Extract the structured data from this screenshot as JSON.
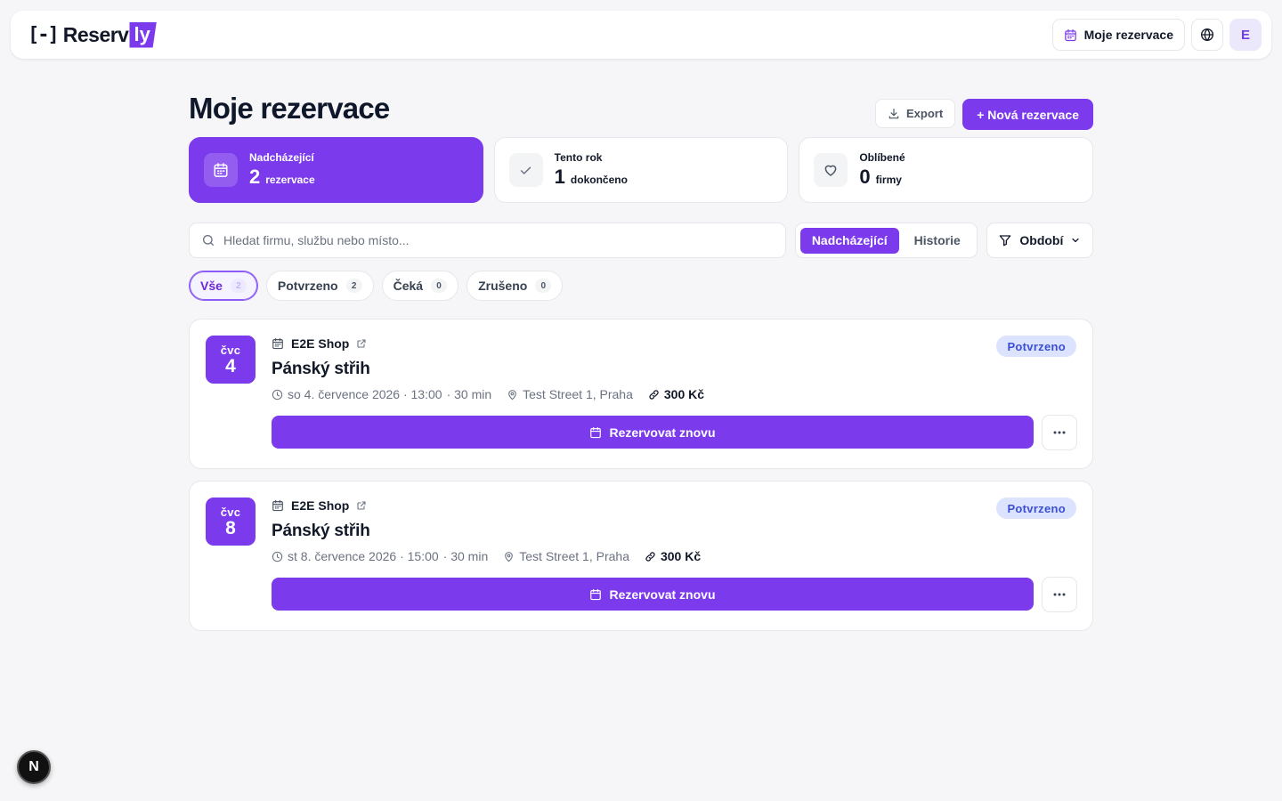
{
  "header": {
    "logo_mark": "[-]",
    "logo_text": "Reserv",
    "logo_badge": "ly",
    "my_reservations_label": "Moje rezervace",
    "avatar_initial": "E"
  },
  "page": {
    "title": "Moje rezervace",
    "export_label": "Export",
    "new_label": "+ Nová rezervace"
  },
  "stats": [
    {
      "label": "Nadcházející",
      "value": "2",
      "unit": "rezervace",
      "icon": "calendar-icon"
    },
    {
      "label": "Tento rok",
      "value": "1",
      "unit": "dokončeno",
      "icon": "check-icon"
    },
    {
      "label": "Oblíbené",
      "value": "0",
      "unit": "firmy",
      "icon": "heart-icon"
    }
  ],
  "search": {
    "placeholder": "Hledat firmu, službu nebo místo..."
  },
  "tabs": [
    "Nadcházející",
    "Historie"
  ],
  "period_label": "Období",
  "chips": [
    {
      "label": "Vše",
      "count": "2"
    },
    {
      "label": "Potvrzeno",
      "count": "2"
    },
    {
      "label": "Čeká",
      "count": "0"
    },
    {
      "label": "Zrušeno",
      "count": "0"
    }
  ],
  "reservations": [
    {
      "month": "čvc",
      "day": "4",
      "shop": "E2E Shop",
      "service": "Pánský střih",
      "datetime": "so 4. července 2026 · 13:00",
      "duration": "· 30 min",
      "location": "Test Street 1, Praha",
      "price": "300 Kč",
      "status": "Potvrzeno",
      "rebook_label": "Rezervovat znovu"
    },
    {
      "month": "čvc",
      "day": "8",
      "shop": "E2E Shop",
      "service": "Pánský střih",
      "datetime": "st 8. července 2026 · 15:00",
      "duration": "· 30 min",
      "location": "Test Street 1, Praha",
      "price": "300 Kč",
      "status": "Potvrzeno",
      "rebook_label": "Rezervovat znovu"
    }
  ],
  "dev_badge": "N",
  "colors": {
    "accent": "#7c3aed",
    "status_bg": "#dbe3ff",
    "status_text": "#3b4fd1"
  }
}
